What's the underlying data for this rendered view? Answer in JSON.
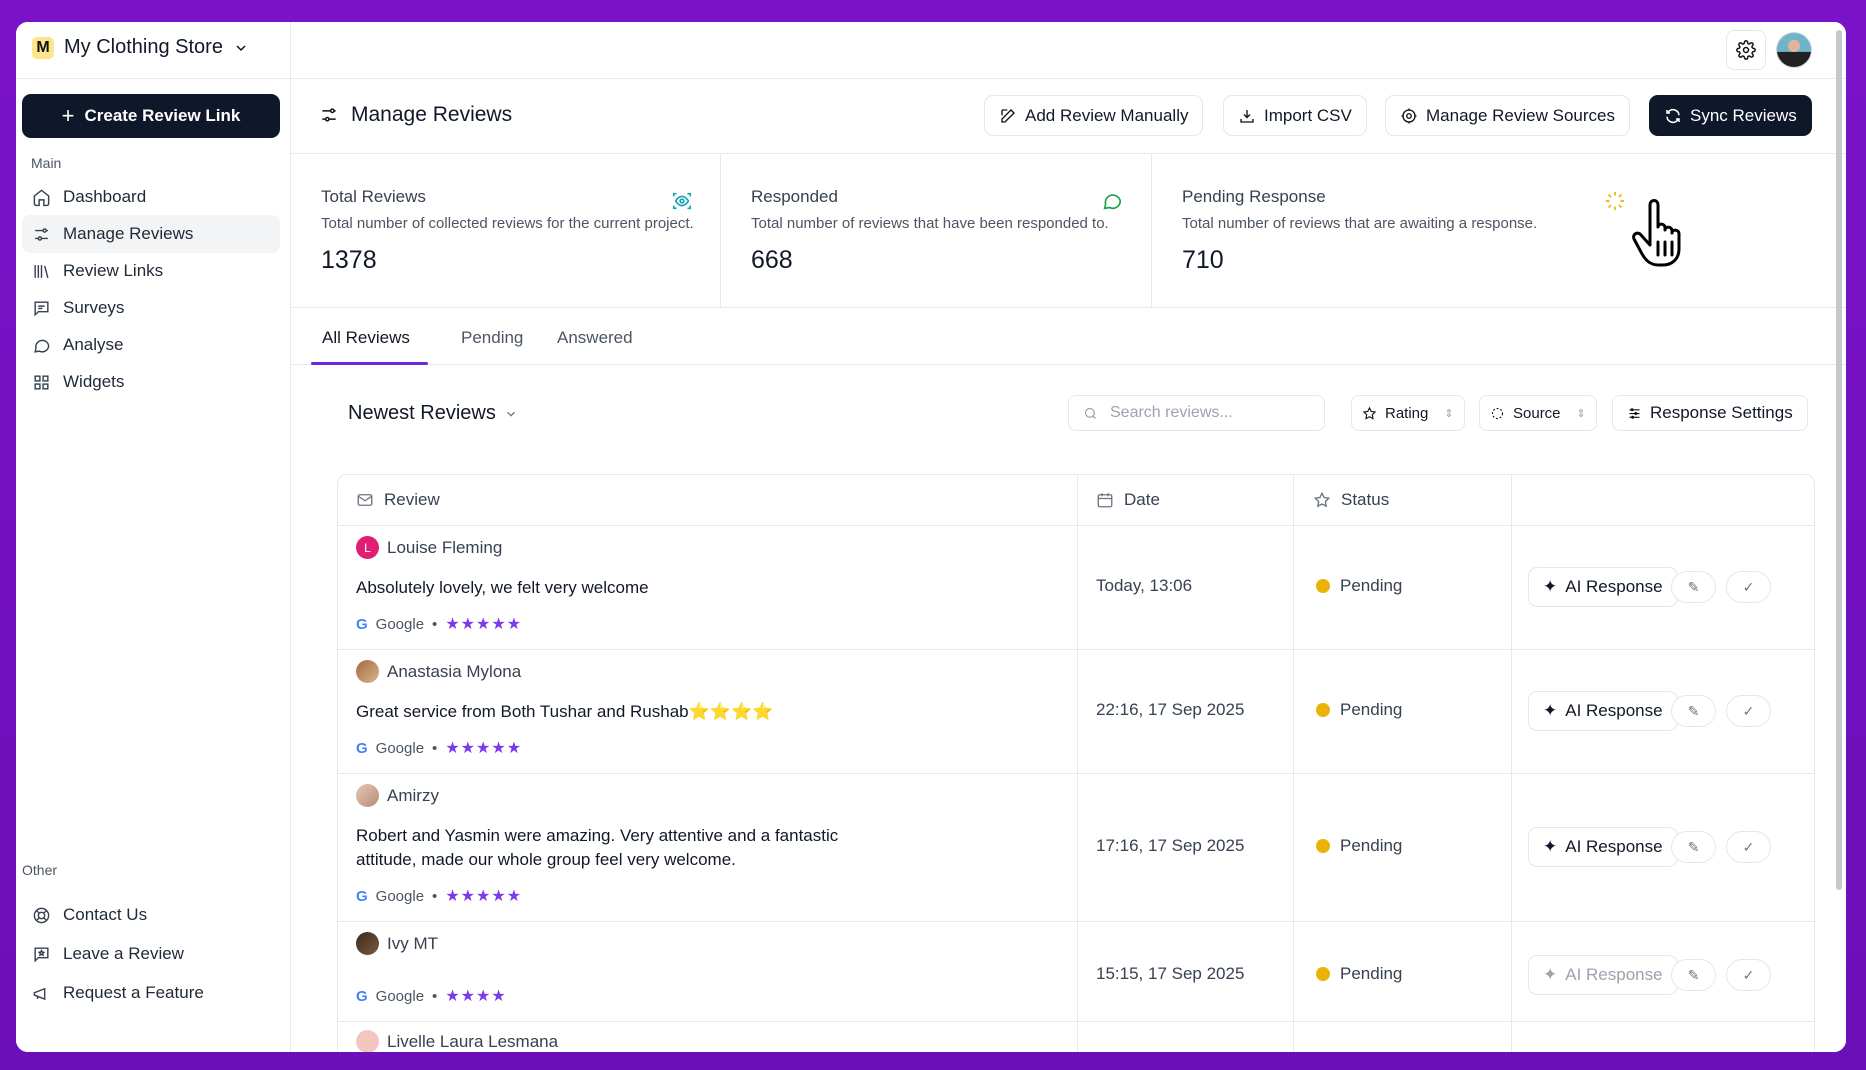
{
  "topbar": {
    "store_initial": "M",
    "store_name": "My Clothing Store"
  },
  "sidebar": {
    "create_label": "Create Review Link",
    "main_section": "Main",
    "items": [
      {
        "label": "Dashboard",
        "icon": "home-icon"
      },
      {
        "label": "Manage Reviews",
        "icon": "sliders-icon"
      },
      {
        "label": "Review Links",
        "icon": "library-icon"
      },
      {
        "label": "Surveys",
        "icon": "message-square-icon"
      },
      {
        "label": "Analyse",
        "icon": "message-circle-icon"
      },
      {
        "label": "Widgets",
        "icon": "grid-icon"
      }
    ],
    "other_section": "Other",
    "other_items": [
      {
        "label": "Contact Us",
        "icon": "lifebuoy-icon"
      },
      {
        "label": "Leave a Review",
        "icon": "review-icon"
      },
      {
        "label": "Request a Feature",
        "icon": "megaphone-icon"
      }
    ]
  },
  "header": {
    "title": "Manage Reviews",
    "add_manual": "Add Review Manually",
    "import_csv": "Import CSV",
    "manage_sources": "Manage Review Sources",
    "sync": "Sync Reviews"
  },
  "stats": [
    {
      "title": "Total Reviews",
      "desc": "Total number of collected reviews for the current project.",
      "value": "1378"
    },
    {
      "title": "Responded",
      "desc": "Total number of reviews that have been responded to.",
      "value": "668"
    },
    {
      "title": "Pending Response",
      "desc": "Total number of reviews that are awaiting a response.",
      "value": "710"
    }
  ],
  "tabs": [
    "All Reviews",
    "Pending",
    "Answered"
  ],
  "toolbar": {
    "sort_label": "Newest Reviews",
    "search_placeholder": "Search reviews...",
    "rating_label": "Rating",
    "source_label": "Source",
    "response_settings": "Response Settings"
  },
  "table": {
    "headers": {
      "review": "Review",
      "date": "Date",
      "status": "Status"
    },
    "ai_label": "AI Response",
    "rows": [
      {
        "name": "Louise Fleming",
        "initial": "L",
        "text": "Absolutely lovely, we felt very welcome",
        "source": "Google",
        "stars": "★★★★★",
        "date": "Today, 13:06",
        "status": "Pending"
      },
      {
        "name": "Anastasia Mylona",
        "initial": "",
        "text": "Great service from Both Tushar and Rushab⭐⭐⭐⭐",
        "source": "Google",
        "stars": "★★★★★",
        "date": "22:16, 17 Sep 2025",
        "status": "Pending"
      },
      {
        "name": "Amirzy",
        "initial": "",
        "text": "Robert and Yasmin were amazing. Very attentive and a fantastic attitude, made our whole group feel very welcome.",
        "source": "Google",
        "stars": "★★★★★",
        "date": "17:16, 17 Sep 2025",
        "status": "Pending"
      },
      {
        "name": "Ivy MT",
        "initial": "",
        "text": "",
        "source": "Google",
        "stars": "★★★★",
        "date": "15:15, 17 Sep 2025",
        "status": "Pending"
      },
      {
        "name": "Livelle Laura Lesmana",
        "initial": "",
        "text": "",
        "source": "",
        "stars": "",
        "date": "",
        "status": ""
      }
    ]
  },
  "colors": {
    "accent": "#6d28d9",
    "dark_button": "#0f172a",
    "pending": "#eab308",
    "star": "#7c3aed",
    "background": "#7a12c9"
  }
}
